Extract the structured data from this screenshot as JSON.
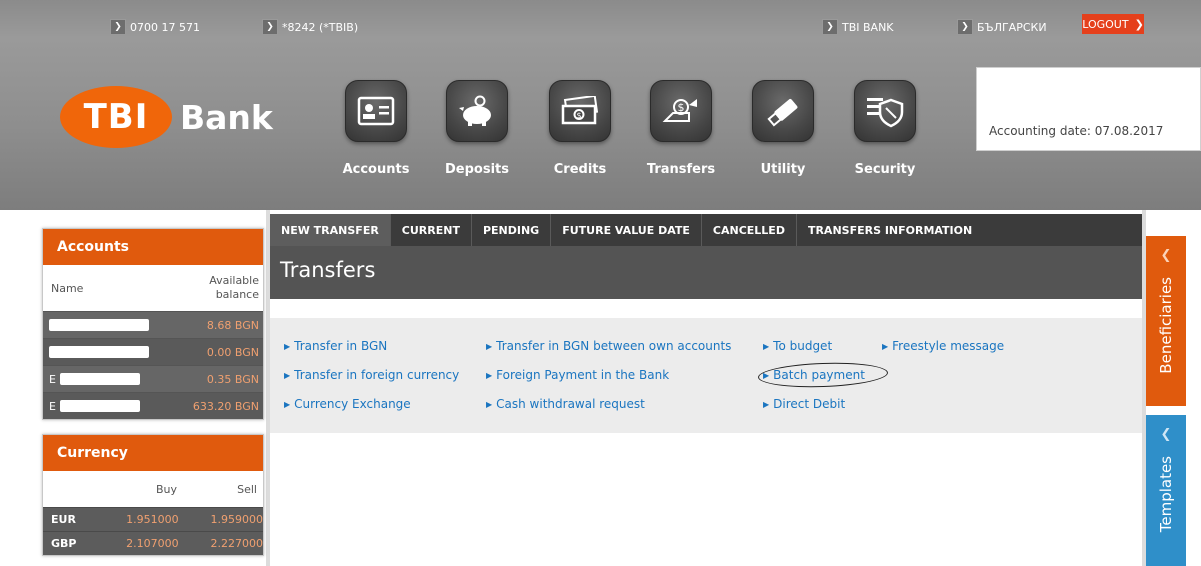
{
  "topbar": {
    "phone": "0700 17 571",
    "shortcode": "*8242 (*TBIB)",
    "bank_link": "TBI BANK",
    "language": "БЪЛГАРСКИ",
    "logout": "LOGOUT"
  },
  "logo": {
    "tbi": "TBI",
    "bank": "Bank"
  },
  "nav": [
    {
      "label": "Accounts",
      "icon": "accounts-icon"
    },
    {
      "label": "Deposits",
      "icon": "piggy-bank-icon"
    },
    {
      "label": "Credits",
      "icon": "money-icon"
    },
    {
      "label": "Transfers",
      "icon": "transfer-icon"
    },
    {
      "label": "Utility",
      "icon": "usb-icon"
    },
    {
      "label": "Security",
      "icon": "shield-icon"
    }
  ],
  "accounting_date": "Accounting date: 07.08.2017",
  "accounts": {
    "title": "Accounts",
    "col_name": "Name",
    "col_balance_1": "Available",
    "col_balance_2": "balance",
    "rows": [
      {
        "name_visible": "",
        "balance": "8.68 BGN"
      },
      {
        "name_visible": "",
        "balance": "0.00 BGN"
      },
      {
        "name_visible": "E",
        "balance": "0.35 BGN"
      },
      {
        "name_visible": "E",
        "balance": "633.20 BGN"
      }
    ]
  },
  "currency": {
    "title": "Currency",
    "col_buy": "Buy",
    "col_sell": "Sell",
    "rows": [
      {
        "ccy": "EUR",
        "buy": "1.951000",
        "sell": "1.959000"
      },
      {
        "ccy": "GBP",
        "buy": "2.107000",
        "sell": "2.227000"
      }
    ]
  },
  "tabs": [
    {
      "label": "NEW TRANSFER",
      "active": true
    },
    {
      "label": "CURRENT"
    },
    {
      "label": "PENDING"
    },
    {
      "label": "FUTURE VALUE DATE"
    },
    {
      "label": "CANCELLED"
    },
    {
      "label": "TRANSFERS INFORMATION"
    }
  ],
  "page_title": "Transfers",
  "links": {
    "bgn": "Transfer in BGN",
    "bgn_own": "Transfer in BGN between own accounts",
    "budget": "To budget",
    "freestyle": "Freestyle message",
    "foreign_currency": "Transfer in foreign currency",
    "foreign_payment": "Foreign Payment in the Bank",
    "batch": "Batch payment",
    "exchange": "Currency Exchange",
    "cash": "Cash withdrawal request",
    "direct_debit": "Direct Debit"
  },
  "side_tabs": {
    "beneficiaries": "Beneficiaries",
    "templates": "Templates"
  },
  "colors": {
    "brand_orange": "#e05a0d",
    "logout_red": "#e5401c",
    "link_blue": "#1a75c0",
    "templates_blue": "#2f8fc9"
  }
}
